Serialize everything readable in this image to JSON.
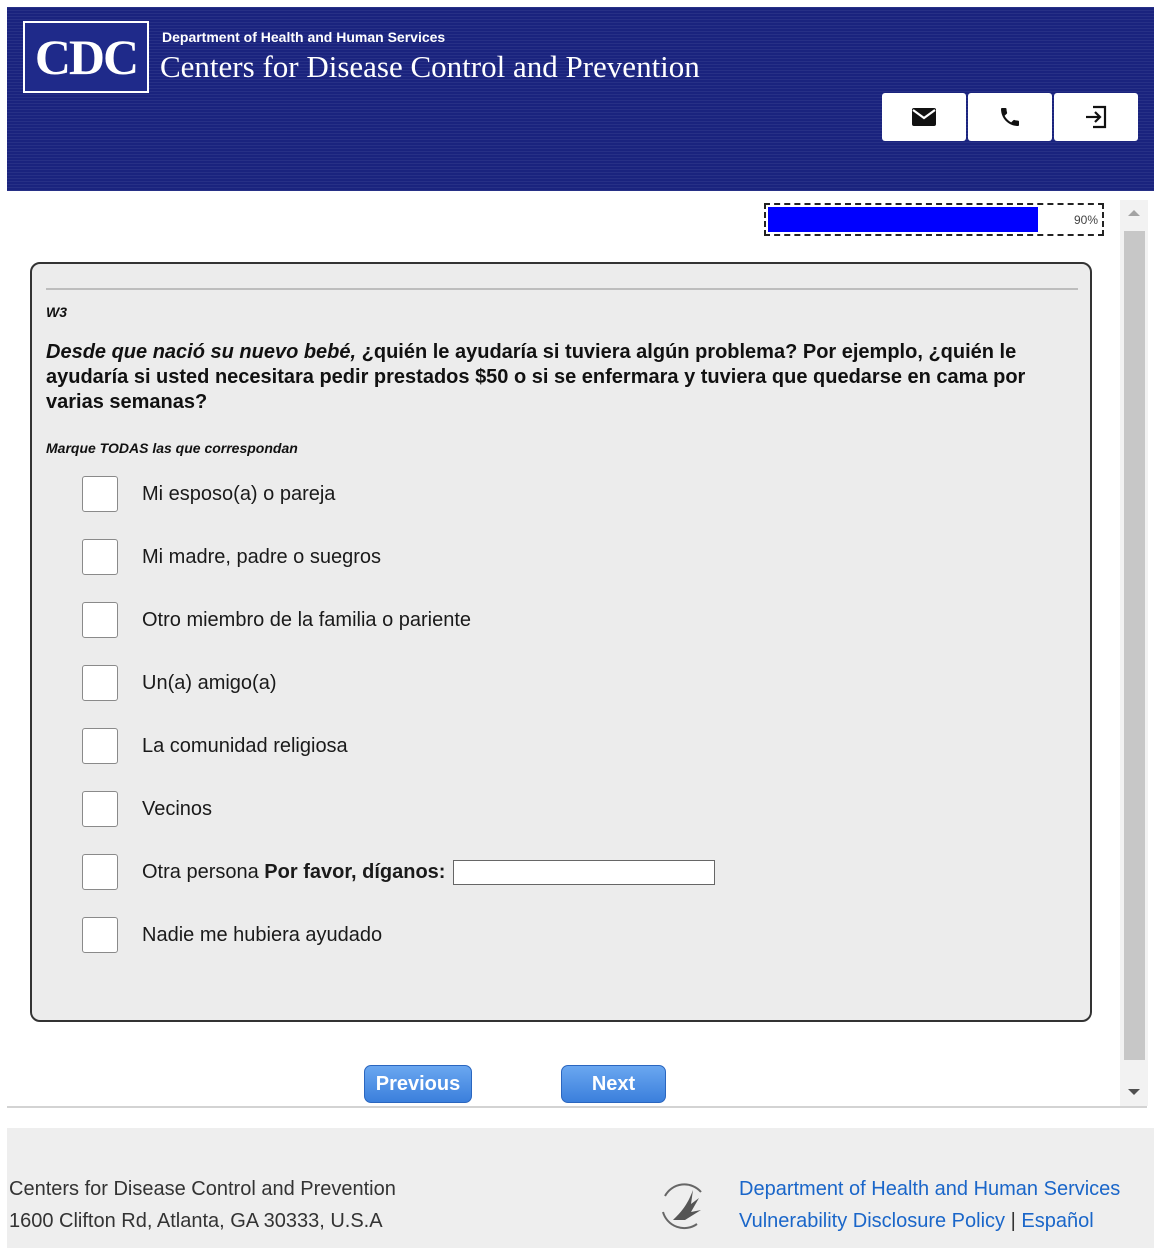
{
  "header": {
    "logo_text": "CDC",
    "dept_label": "Department of Health and Human Services",
    "org_name": "Centers for Disease Control and Prevention",
    "buttons": [
      {
        "icon": "mail-icon"
      },
      {
        "icon": "phone-icon"
      },
      {
        "icon": "exit-icon"
      }
    ]
  },
  "progress": {
    "value": 0.9,
    "label": "90%"
  },
  "question": {
    "id": "W3",
    "text_italic": "Desde que nació su nuevo bebé,",
    "text_rest": " ¿quién le ayudaría si tuviera algún problema? Por ejemplo, ¿quién le ayudaría si usted necesitara pedir prestados $50 o si se enfermara y tuviera que quedarse en cama por varias semanas?",
    "instruction": "Marque TODAS las que correspondan",
    "options": [
      {
        "label": "Mi esposo(a) o pareja"
      },
      {
        "label": "Mi madre, padre o suegros"
      },
      {
        "label": "Otro miembro de la familia o pariente"
      },
      {
        "label": "Un(a) amigo(a)"
      },
      {
        "label": "La comunidad religiosa"
      },
      {
        "label": "Vecinos"
      },
      {
        "label": "Otra persona",
        "prompt": "Por favor, díganos:",
        "input_value": ""
      },
      {
        "label": "Nadie me hubiera ayudado"
      }
    ]
  },
  "nav": {
    "previous": "Previous",
    "next": "Next"
  },
  "footer": {
    "org_line": "Centers for Disease Control and Prevention",
    "address": "1600 Clifton Rd, Atlanta, GA 30333, U.S.A",
    "hhs_link": "Department of Health and Human Services",
    "vdp_link": "Vulnerability Disclosure Policy",
    "separator": "|",
    "espanol_link": "Español"
  },
  "colors": {
    "header_bg": "#1a237e",
    "progress_fill": "#0000ff",
    "button_blue": "#3b7fdc",
    "link": "#1a66c9"
  }
}
